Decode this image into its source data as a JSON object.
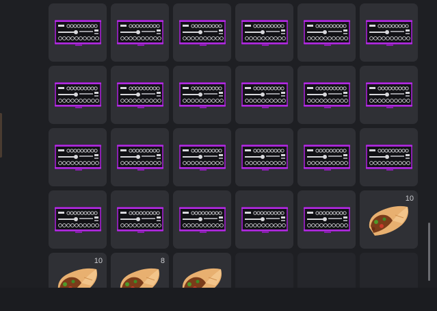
{
  "inventory": {
    "slots": [
      {
        "item": "socket-set-case-icon",
        "qty": ""
      },
      {
        "item": "socket-set-case-icon",
        "qty": ""
      },
      {
        "item": "socket-set-case-icon",
        "qty": ""
      },
      {
        "item": "socket-set-case-icon",
        "qty": ""
      },
      {
        "item": "socket-set-case-icon",
        "qty": ""
      },
      {
        "item": "socket-set-case-icon",
        "qty": ""
      },
      {
        "item": "socket-set-case-icon",
        "qty": ""
      },
      {
        "item": "socket-set-case-icon",
        "qty": ""
      },
      {
        "item": "socket-set-case-icon",
        "qty": ""
      },
      {
        "item": "socket-set-case-icon",
        "qty": ""
      },
      {
        "item": "socket-set-case-icon",
        "qty": ""
      },
      {
        "item": "socket-set-case-icon",
        "qty": ""
      },
      {
        "item": "socket-set-case-icon",
        "qty": ""
      },
      {
        "item": "socket-set-case-icon",
        "qty": ""
      },
      {
        "item": "socket-set-case-icon",
        "qty": ""
      },
      {
        "item": "socket-set-case-icon",
        "qty": ""
      },
      {
        "item": "socket-set-case-icon",
        "qty": ""
      },
      {
        "item": "socket-set-case-icon",
        "qty": ""
      },
      {
        "item": "socket-set-case-icon",
        "qty": ""
      },
      {
        "item": "socket-set-case-icon",
        "qty": ""
      },
      {
        "item": "socket-set-case-icon",
        "qty": ""
      },
      {
        "item": "socket-set-case-icon",
        "qty": ""
      },
      {
        "item": "socket-set-case-icon",
        "qty": ""
      },
      {
        "item": "burrito-icon",
        "qty": "10"
      },
      {
        "item": "burrito-icon",
        "qty": "10"
      },
      {
        "item": "burrito-icon",
        "qty": "8"
      },
      {
        "item": "burrito-icon",
        "qty": ""
      },
      {
        "item": "",
        "qty": ""
      },
      {
        "item": "",
        "qty": ""
      },
      {
        "item": "",
        "qty": ""
      }
    ]
  },
  "colors": {
    "background": "#1e1f23",
    "slot": "#2f3035",
    "case_accent": "#a020c8",
    "wrap_tortilla": "#e8b070"
  }
}
